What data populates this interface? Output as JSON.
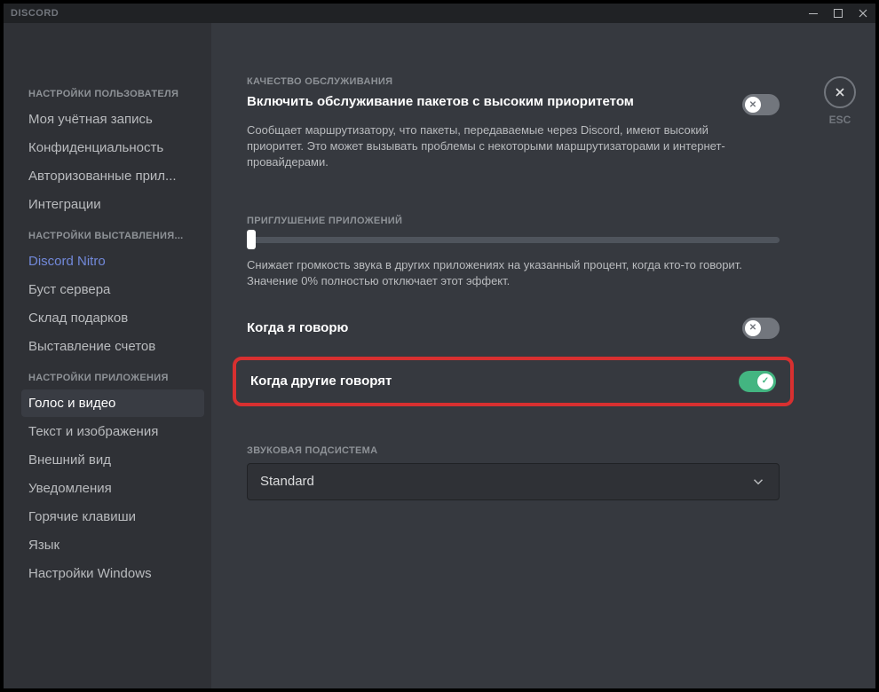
{
  "titlebar": {
    "title": "DISCORD"
  },
  "esc": {
    "label": "ESC"
  },
  "sidebar": {
    "section1": {
      "header": "НАСТРОЙКИ ПОЛЬЗОВАТЕЛЯ",
      "items": [
        "Моя учётная запись",
        "Конфиденциальность",
        "Авторизованные прил...",
        "Интеграции"
      ]
    },
    "section2": {
      "header": "НАСТРОЙКИ ВЫСТАВЛЕНИЯ...",
      "items": [
        "Discord Nitro",
        "Буст сервера",
        "Склад подарков",
        "Выставление счетов"
      ]
    },
    "section3": {
      "header": "НАСТРОЙКИ ПРИЛОЖЕНИЯ",
      "items": [
        "Голос и видео",
        "Текст и изображения",
        "Внешний вид",
        "Уведомления",
        "Горячие клавиши",
        "Язык",
        "Настройки Windows"
      ]
    }
  },
  "content": {
    "qos": {
      "header": "КАЧЕСТВО ОБСЛУЖИВАНИЯ",
      "title": "Включить обслуживание пакетов с высоким приоритетом",
      "desc": "Сообщает маршрутизатору, что пакеты, передаваемые через Discord, имеют высокий приоритет. Это может вызывать проблемы с некоторыми маршрутизаторами и интернет-провайдерами."
    },
    "attenuation": {
      "header": "ПРИГЛУШЕНИЕ ПРИЛОЖЕНИЙ",
      "desc": "Снижает громкость звука в других приложениях на указанный процент, когда кто-то говорит. Значение 0% полностью отключает этот эффект.",
      "when_i_speak": "Когда я говорю",
      "when_others_speak": "Когда другие говорят"
    },
    "audio": {
      "header": "ЗВУКОВАЯ ПОДСИСТЕМА",
      "value": "Standard"
    }
  }
}
